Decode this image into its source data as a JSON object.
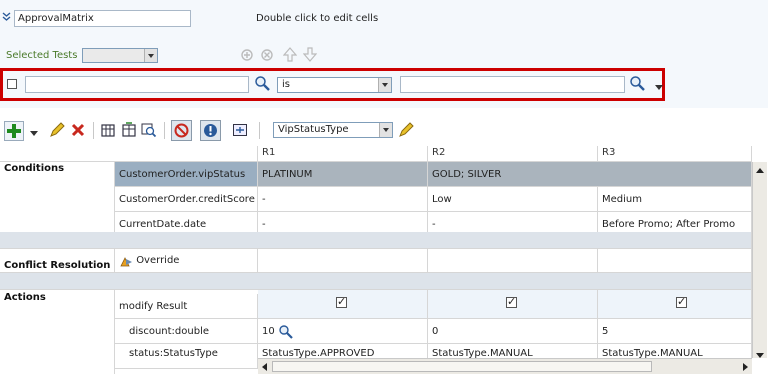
{
  "header": {
    "name_value": "ApprovalMatrix",
    "hint": "Double click to edit cells",
    "selected_tests_label": "Selected Tests"
  },
  "filter": {
    "operator": "is"
  },
  "toolbar": {
    "type_select": "VipStatusType"
  },
  "columns": [
    "R1",
    "R2",
    "R3"
  ],
  "sections": {
    "conditions": "Conditions",
    "conflict": "Conflict Resolution",
    "actions": "Actions"
  },
  "conditions": [
    {
      "label": "CustomerOrder.vipStatus",
      "cells": [
        "PLATINUM",
        "GOLD; SILVER",
        ""
      ]
    },
    {
      "label": "CustomerOrder.creditScore",
      "cells": [
        "-",
        "Low",
        "Medium"
      ]
    },
    {
      "label": "CurrentDate.date",
      "cells": [
        "-",
        "-",
        "Before Promo; After Promo"
      ]
    }
  ],
  "conflict": {
    "label": "Override"
  },
  "actions": {
    "modify_label": "modify Result",
    "rows": [
      {
        "label": "discount:double",
        "cells": [
          "10",
          "0",
          "5"
        ]
      },
      {
        "label": "status:StatusType",
        "cells": [
          "StatusType.APPROVED",
          "StatusType.MANUAL",
          "StatusType.MANUAL"
        ]
      }
    ],
    "checked": [
      true,
      true,
      true
    ]
  },
  "colors": {
    "accent_red": "#cc0000",
    "selected_cell": "#9aaec1",
    "band": "#dde3ea"
  }
}
